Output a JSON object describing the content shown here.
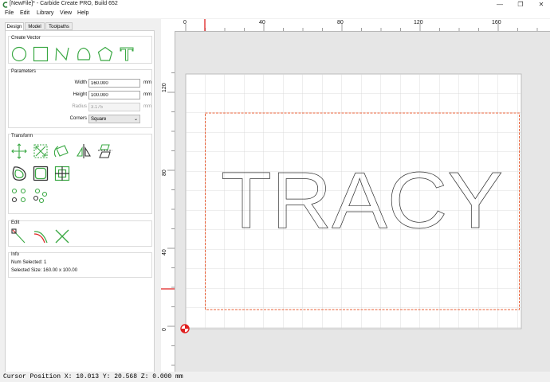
{
  "window": {
    "title": "[NewFile]* - Carbide Create PRO, Build 652",
    "buttons": [
      "—",
      "❐",
      "✕"
    ]
  },
  "menu": [
    "File",
    "Edit",
    "Library",
    "View",
    "Help"
  ],
  "tabs": [
    "Design",
    "Model",
    "Toolpaths"
  ],
  "create_vector": {
    "title": "Create Vector",
    "tools": [
      "circle-icon",
      "rectangle-icon",
      "polyline-icon",
      "curve-icon",
      "polygon-icon",
      "text-icon"
    ]
  },
  "parameters": {
    "title": "Parameters",
    "width_label": "Width",
    "width_value": "160.000",
    "height_label": "Height",
    "height_value": "100.000",
    "radius_label": "Radius",
    "radius_value": "3.175",
    "unit": "mm",
    "corners_label": "Corners",
    "corners_value": "Square"
  },
  "transform": {
    "title": "Transform",
    "tools": [
      "move-icon",
      "scale-icon",
      "rotate-icon",
      "mirror-icon",
      "align-icon",
      "offset-icon",
      "fillet-icon",
      "center-icon",
      "circular-array-icon",
      "linear-array-icon"
    ]
  },
  "edit": {
    "title": "Edit",
    "tools": [
      "node-edit-icon",
      "trim-icon",
      "delete-icon"
    ]
  },
  "info": {
    "title": "Info",
    "num_selected_label": "Num Selected:",
    "num_selected_value": "1",
    "selected_size_label": "Selected Size:",
    "selected_size_value": "160.00 x 100.00"
  },
  "ruler": {
    "h_labels": [
      "0",
      "40",
      "80",
      "120",
      "160"
    ],
    "v_labels": [
      "120",
      "80",
      "40",
      "0"
    ]
  },
  "canvas": {
    "text": "TRACY",
    "colors": {
      "selection": "#e8623a",
      "grid": "#d4d4d4",
      "stock": "#ffffff",
      "tool_green": "#3aa843",
      "marker": "#e02020"
    }
  },
  "status": {
    "cursor": "Cursor Position X: 10.013 Y: 20.568 Z: 0.000 mm"
  }
}
